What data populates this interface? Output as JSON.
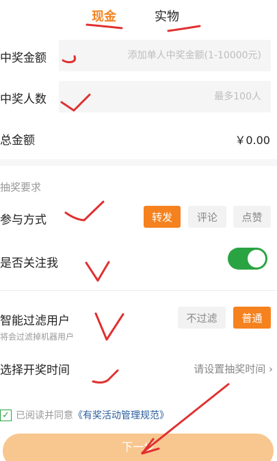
{
  "tabs": {
    "cash": "现金",
    "physical": "实物"
  },
  "prize_amount": {
    "label": "中奖金额",
    "placeholder": "添加单人中奖金额(1-10000元)"
  },
  "winners": {
    "label": "中奖人数",
    "placeholder": "最多100人"
  },
  "total": {
    "label": "总金额",
    "value": "￥0.00"
  },
  "requirements": {
    "section_title": "抽奖要求",
    "participation": {
      "label": "参与方式",
      "options": [
        "转发",
        "评论",
        "点赞"
      ],
      "selected": "转发"
    },
    "follow": {
      "label": "是否关注我",
      "enabled": true
    },
    "filter": {
      "label": "智能过滤用户",
      "note": "将会过滤掉机器用户",
      "options": [
        "不过滤",
        "普通"
      ],
      "selected": "普通"
    },
    "draw_time": {
      "label": "选择开奖时间",
      "value": "请设置抽奖时间",
      "chevron": "›"
    }
  },
  "agreement": {
    "check": "✓",
    "prefix": "已阅读并同意",
    "policy": "《有奖活动管理规范》"
  },
  "next_button": "下一步",
  "colors": {
    "accent": "#f5821f",
    "toggle_on": "#2aa342",
    "annotation": "#e03030",
    "link": "#2b5d9c"
  }
}
